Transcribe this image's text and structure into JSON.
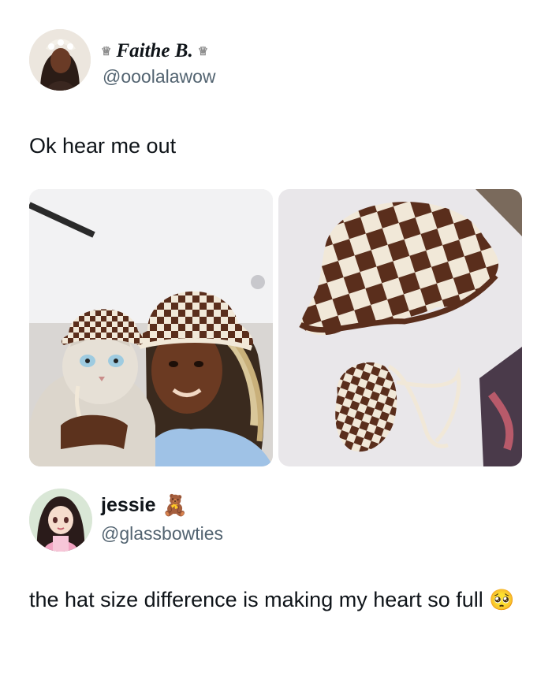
{
  "post1": {
    "display_name": "Faithe B.",
    "name_decor": "♕",
    "handle": "@ooolalawow",
    "text": "Ok hear me out",
    "media": [
      {
        "icon": "photo-woman-cat-hats"
      },
      {
        "icon": "photo-two-hats-table"
      }
    ]
  },
  "post2": {
    "display_name": "jessie",
    "name_emoji": "🧸",
    "handle": "@glassbowties",
    "text": "the hat size difference is making my heart so full",
    "emoji": "🥺"
  },
  "colors": {
    "text": "#0f1419",
    "handle": "#536471",
    "hat_brown": "#5a2e1c",
    "hat_cream": "#f1e8d8"
  }
}
